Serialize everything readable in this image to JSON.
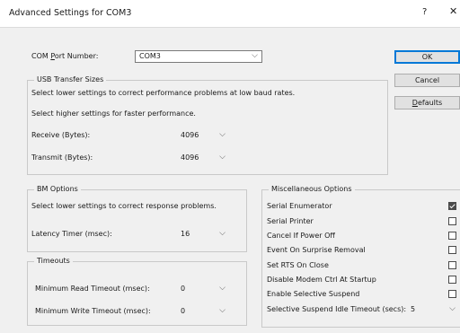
{
  "window": {
    "title": "Advanced Settings for COM3",
    "help_label": "?",
    "close_label": "✕"
  },
  "com_port": {
    "label_pre": "COM ",
    "label_ul": "P",
    "label_post": "ort Number:",
    "value": "COM3"
  },
  "buttons": {
    "ok": "OK",
    "cancel": "Cancel",
    "defaults_ul": "D",
    "defaults_rest": "efaults"
  },
  "usb": {
    "legend": "USB Transfer Sizes",
    "hint1": "Select lower settings to correct performance problems at low baud rates.",
    "hint2": "Select higher settings for faster performance.",
    "receive_label": "Receive (Bytes):",
    "receive_value": "4096",
    "transmit_label": "Transmit (Bytes):",
    "transmit_value": "4096"
  },
  "bm": {
    "legend": "BM Options",
    "hint": "Select lower settings to correct response problems.",
    "latency_label": "Latency Timer (msec):",
    "latency_value": "16"
  },
  "timeouts": {
    "legend": "Timeouts",
    "read_label": "Minimum Read Timeout (msec):",
    "read_value": "0",
    "write_label": "Minimum Write Timeout (msec):",
    "write_value": "0"
  },
  "misc": {
    "legend": "Miscellaneous Options",
    "options": [
      {
        "label": "Serial Enumerator",
        "checked": true
      },
      {
        "label": "Serial Printer",
        "checked": false
      },
      {
        "label": "Cancel If Power Off",
        "checked": false
      },
      {
        "label": "Event On Surprise Removal",
        "checked": false
      },
      {
        "label": "Set RTS On Close",
        "checked": false
      },
      {
        "label": "Disable Modem Ctrl At Startup",
        "checked": false
      },
      {
        "label": "Enable Selective Suspend",
        "checked": false
      }
    ],
    "idle_label": "Selective Suspend Idle Timeout (secs):",
    "idle_value": "5"
  }
}
